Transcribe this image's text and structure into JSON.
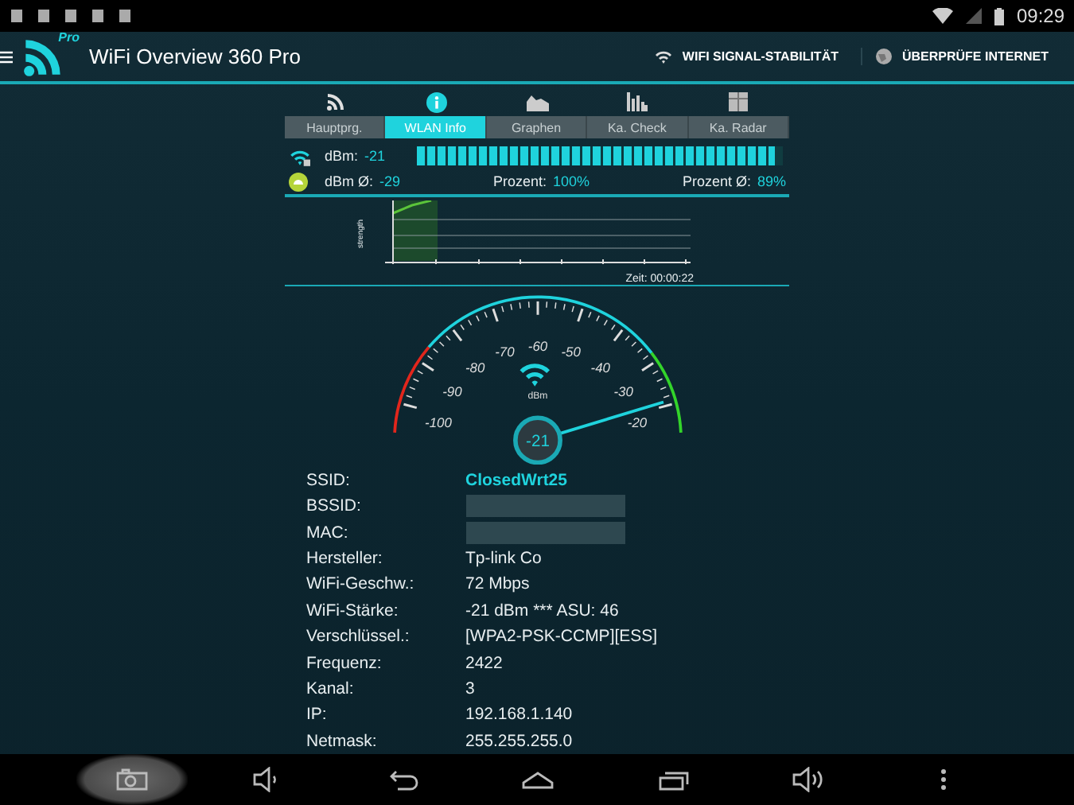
{
  "status_bar": {
    "time": "09:29"
  },
  "app_bar": {
    "logo_badge": "Pro",
    "title": "WiFi Overview 360 Pro",
    "actions": [
      {
        "kind": "wifi",
        "label": "WIFI SIGNAL-STABILITÄT"
      },
      {
        "kind": "globe",
        "label": "ÜBERPRÜFE INTERNET"
      }
    ]
  },
  "tabs": [
    {
      "label": "Hauptprg.",
      "kind": "wifi",
      "selected": false
    },
    {
      "label": "WLAN Info",
      "kind": "info",
      "selected": true
    },
    {
      "label": "Graphen",
      "kind": "area",
      "selected": false
    },
    {
      "label": "Ka. Check",
      "kind": "bars",
      "selected": false
    },
    {
      "label": "Ka. Radar",
      "kind": "radar",
      "selected": false
    }
  ],
  "signal": {
    "dbm_label": "dBm:",
    "dbm_value": "-21",
    "level": 0.98,
    "avg_label": "dBm Ø:",
    "avg_value": "-29",
    "percent_label": "Prozent:",
    "percent_value": "100%",
    "percent_avg_label": "Prozent Ø:",
    "percent_avg_value": "89%"
  },
  "graph": {
    "ylabel": "strength",
    "time": "Zeit: 00:00:22"
  },
  "gauge": {
    "ticks": [
      "-100",
      "-90",
      "-80",
      "-70",
      "-60",
      "-50",
      "-40",
      "-30",
      "-20"
    ],
    "unit": "dBm",
    "reading": "-21"
  },
  "info": [
    {
      "label": "SSID:",
      "value": "ClosedWrt25",
      "kind": "highlight"
    },
    {
      "label": "BSSID:",
      "kind": "hidden"
    },
    {
      "label": "MAC:",
      "kind": "hidden"
    },
    {
      "label": "Hersteller:",
      "value": "Tp-link Co",
      "kind": "text"
    },
    {
      "label": "WiFi-Geschw.:",
      "value": "72 Mbps",
      "kind": "text"
    },
    {
      "label": "WiFi-Stärke:",
      "value": "-21 dBm *** ASU: 46",
      "kind": "text"
    },
    {
      "label": "Verschlüssel.:",
      "value": "[WPA2-PSK-CCMP][ESS]",
      "kind": "text"
    },
    {
      "label": "Frequenz:",
      "value": "2422",
      "kind": "text"
    },
    {
      "label": "Kanal:",
      "value": "3",
      "kind": "text"
    },
    {
      "label": "IP:",
      "value": "192.168.1.140",
      "kind": "text"
    },
    {
      "label": "Netmask:",
      "value": "255.255.255.0",
      "kind": "text"
    }
  ],
  "nav_bar": [
    {
      "kind": "camera",
      "selected": true
    },
    {
      "kind": "vol-down",
      "selected": false
    },
    {
      "kind": "back",
      "selected": false
    },
    {
      "kind": "home",
      "selected": false
    },
    {
      "kind": "recents",
      "selected": false
    },
    {
      "kind": "vol-up",
      "selected": false
    },
    {
      "kind": "menu",
      "selected": false
    }
  ]
}
